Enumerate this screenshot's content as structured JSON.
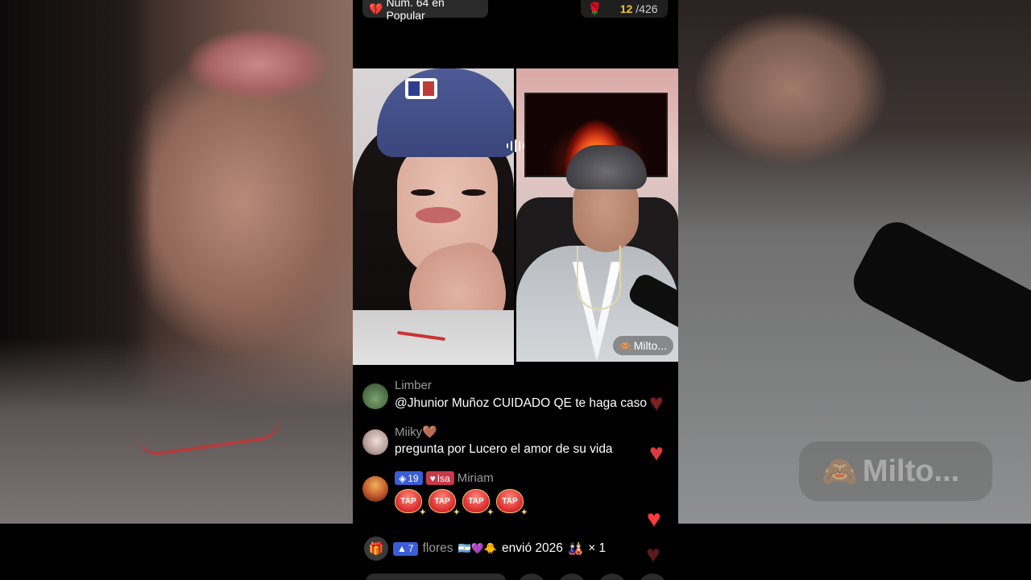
{
  "header": {
    "rank_label": "Núm. 64 en Popular",
    "rank_icon": "broken-heart-icon",
    "count_current": "12",
    "count_total": "/426",
    "count_icon": "rose-icon"
  },
  "stream": {
    "host_name": "Milto...",
    "host_emoji": "🙈",
    "background_tag": "Milto...",
    "background_tag_emoji": "🙈"
  },
  "chat": [
    {
      "user": "Limber",
      "text": "@Jhunior Muñoz CUIDADO QE te haga caso"
    },
    {
      "user": "Miiky🤎",
      "text": "pregunta por Lucero el amor de su vida"
    },
    {
      "user": "Miriam",
      "level": "19",
      "fan_badge": "Isa",
      "taps": [
        "TAP",
        "TAP",
        "TAP",
        "TAP"
      ]
    }
  ],
  "gift": {
    "level": "7",
    "user": "flores",
    "emojis": "🇦🇷💜🐥",
    "action": "envió 2026",
    "gift_emoji": "🎎",
    "multiplier": "× 1"
  },
  "colors": {
    "accent_gold": "#f1c232",
    "level_badge": "#3b5dd6",
    "fan_badge": "#c83a4a",
    "heart": "#e03a3e"
  }
}
